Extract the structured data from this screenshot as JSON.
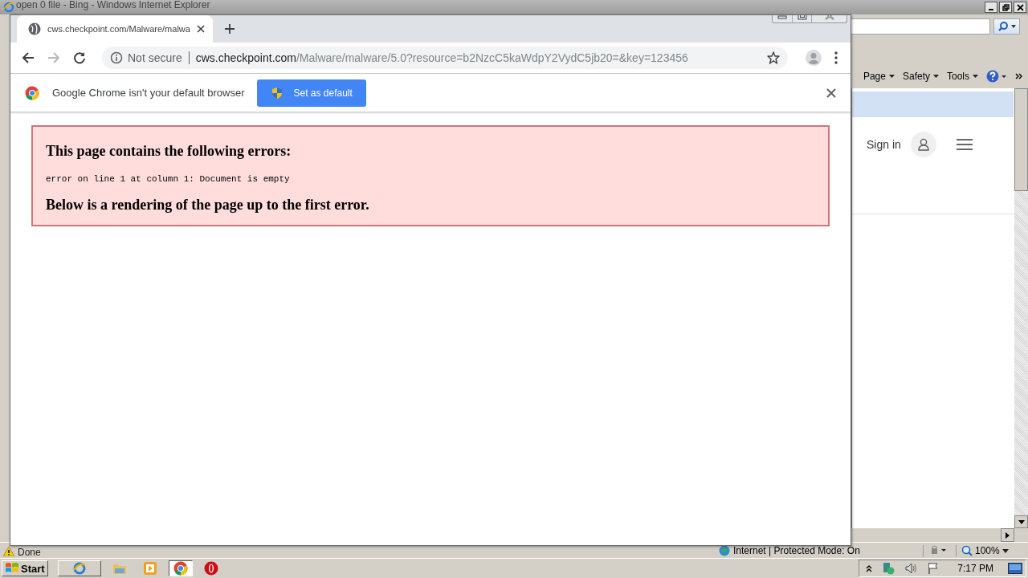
{
  "background_window": {
    "title": "open 0 file - Bing - Windows Internet Explorer",
    "commands": [
      {
        "label": "Page"
      },
      {
        "label": "Safety"
      },
      {
        "label": "Tools"
      }
    ],
    "sign_in": "Sign in",
    "status_bar": {
      "status": "Done",
      "zone": "Internet | Protected Mode: On",
      "zoom": "100%"
    }
  },
  "browser": {
    "tabs": [
      {
        "title": "cws.checkpoint.com/Malware/malwa",
        "selected": true
      }
    ],
    "address": {
      "security": "Not secure",
      "host": "cws.checkpoint.com",
      "path": "/Malware/malware/5.0?resource=b2NzcC5kaWdpY2VydC5jb20=&key=123456"
    },
    "infobar": {
      "message": "Google Chrome isn't your default browser",
      "button": "Set as default"
    },
    "page": {
      "heading": "This page contains the following errors:",
      "error": "error on line 1 at column 1: Document is empty",
      "footer": "Below is a rendering of the page up to the first error."
    }
  },
  "taskbar": {
    "start": "Start",
    "clock": "7:17 PM"
  }
}
